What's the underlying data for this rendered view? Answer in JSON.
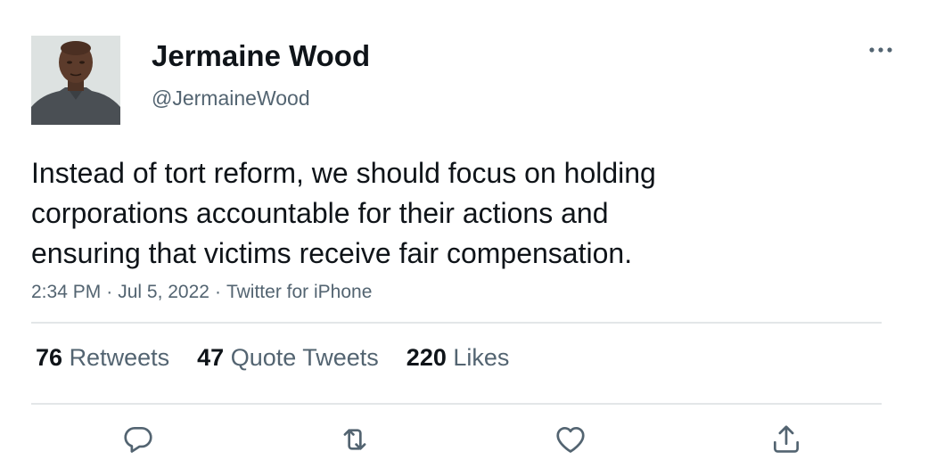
{
  "author": {
    "name": "Jermaine Wood",
    "handle": "@JermaineWood",
    "avatar_icon": "profile-photo"
  },
  "tweet": {
    "text_lines": [
      "Instead of tort reform, we should focus on holding",
      "corporations accountable for their actions and",
      "ensuring that victims receive fair compensation."
    ],
    "time": "2:34 PM",
    "date": "Jul 5, 2022",
    "source": "Twitter for iPhone",
    "separator": "·"
  },
  "stats": {
    "retweets": {
      "count": "76",
      "label": "Retweets"
    },
    "quotes": {
      "count": "47",
      "label": "Quote Tweets"
    },
    "likes": {
      "count": "220",
      "label": "Likes"
    }
  },
  "actions": [
    "reply-icon",
    "retweet-icon",
    "like-icon",
    "share-icon"
  ],
  "colors": {
    "text": "#0f1419",
    "secondary": "#536471",
    "divider": "#e3e6e8",
    "icon": "#536471"
  }
}
